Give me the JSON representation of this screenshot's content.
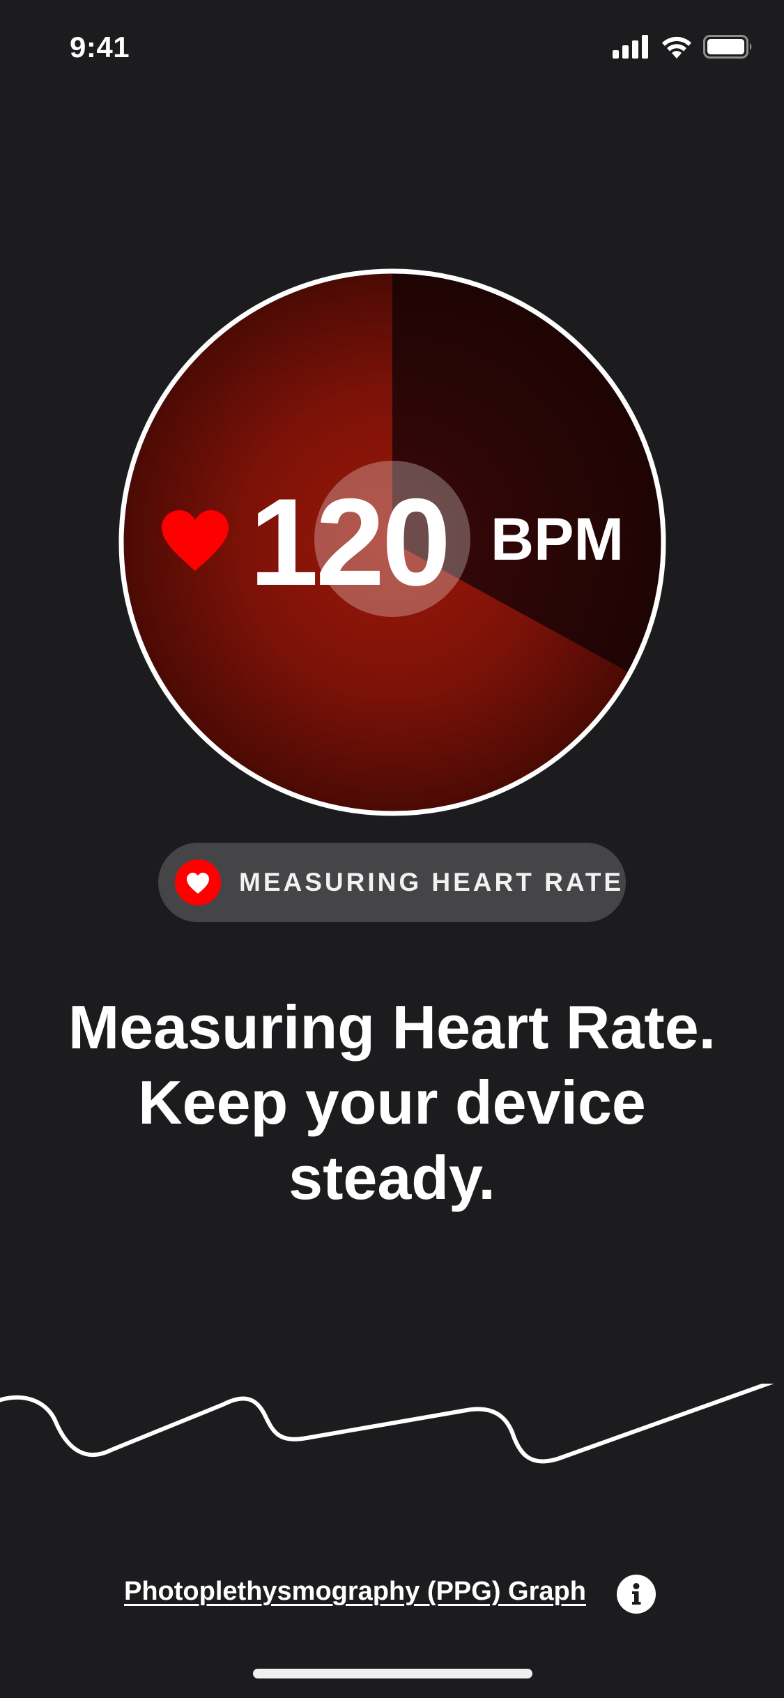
{
  "status_bar": {
    "time": "9:41",
    "signal_icon": "cellular-signal-icon",
    "wifi_icon": "wifi-icon",
    "battery_icon": "battery-icon"
  },
  "measurement": {
    "value": "120",
    "unit": "BPM",
    "progress": 0.33,
    "heart_icon": "heart-icon",
    "colors": {
      "accent": "#ff0000",
      "dial_center": "#9a1608",
      "dial_edge": "#4a0a04",
      "dial_remaining": "#200505"
    }
  },
  "status_pill": {
    "icon": "heart-badge-icon",
    "label": "MEASURING HEART RATE"
  },
  "headline": {
    "line1": "Measuring Heart Rate.",
    "line2": "Keep your device",
    "line3": "steady."
  },
  "graph": {
    "name": "ppg-waveform"
  },
  "footer": {
    "link_label": "Photoplethysmography (PPG) Graph",
    "info_icon": "info-icon"
  }
}
